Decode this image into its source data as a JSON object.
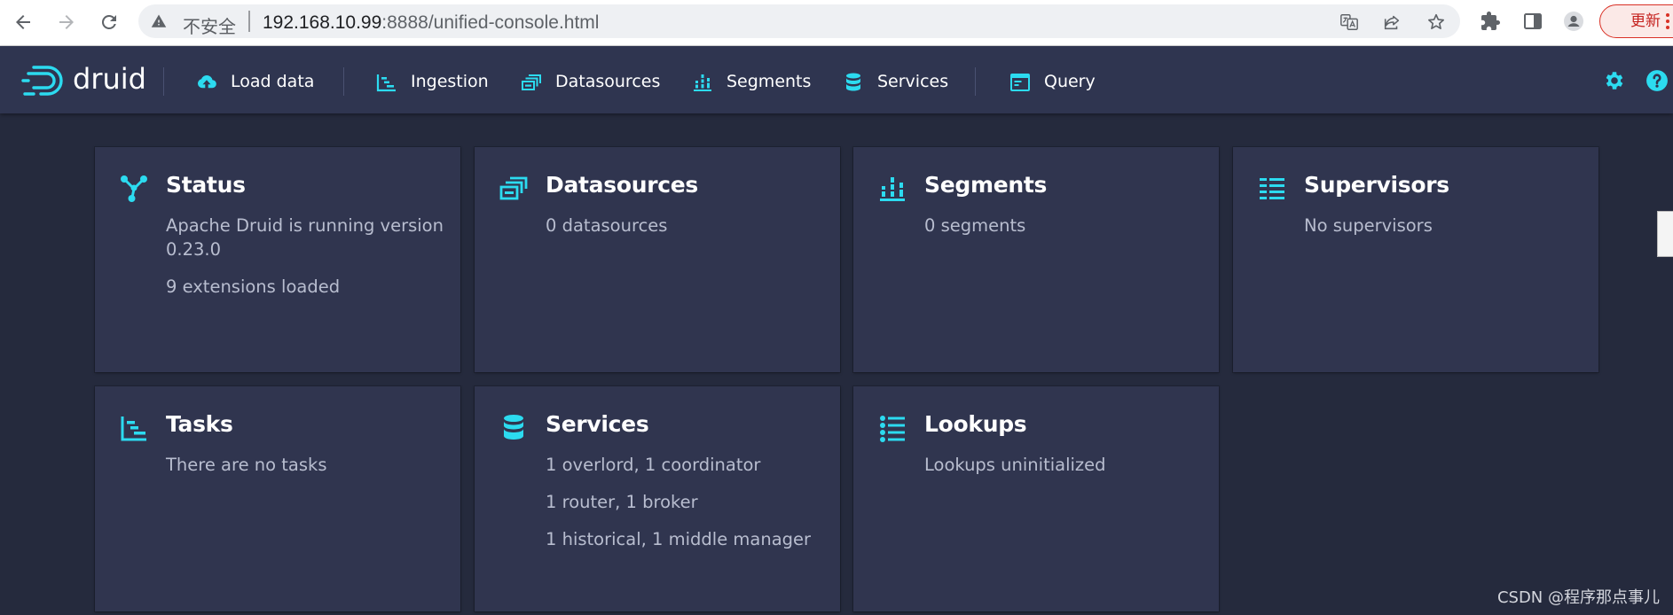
{
  "browser": {
    "insecure_label": "不安全",
    "url_host": "192.168.10.99",
    "url_rest": ":8888/unified-console.html",
    "update_label": "更新"
  },
  "app": {
    "logo_text": "druid",
    "accent_color": "#2cdbf0",
    "nav": [
      {
        "label": "Load data",
        "icon": "cloud-upload-icon"
      },
      {
        "label": "Ingestion",
        "icon": "gantt-chart-icon"
      },
      {
        "label": "Datasources",
        "icon": "multi-select-icon"
      },
      {
        "label": "Segments",
        "icon": "stacked-chart-icon"
      },
      {
        "label": "Services",
        "icon": "database-icon"
      },
      {
        "label": "Query",
        "icon": "application-icon"
      }
    ]
  },
  "cards": {
    "status": {
      "title": "Status",
      "lines": [
        "Apache Druid is running version 0.23.0",
        "9 extensions loaded"
      ]
    },
    "datasources": {
      "title": "Datasources",
      "lines": [
        "0 datasources"
      ]
    },
    "segments": {
      "title": "Segments",
      "lines": [
        "0 segments"
      ]
    },
    "supervisors": {
      "title": "Supervisors",
      "lines": [
        "No supervisors"
      ]
    },
    "tasks": {
      "title": "Tasks",
      "lines": [
        "There are no tasks"
      ]
    },
    "services": {
      "title": "Services",
      "lines": [
        "1 overlord, 1 coordinator",
        "1 router, 1 broker",
        "1 historical, 1 middle manager"
      ]
    },
    "lookups": {
      "title": "Lookups",
      "lines": [
        "Lookups uninitialized"
      ]
    }
  },
  "watermark": "CSDN @程序那点事儿"
}
